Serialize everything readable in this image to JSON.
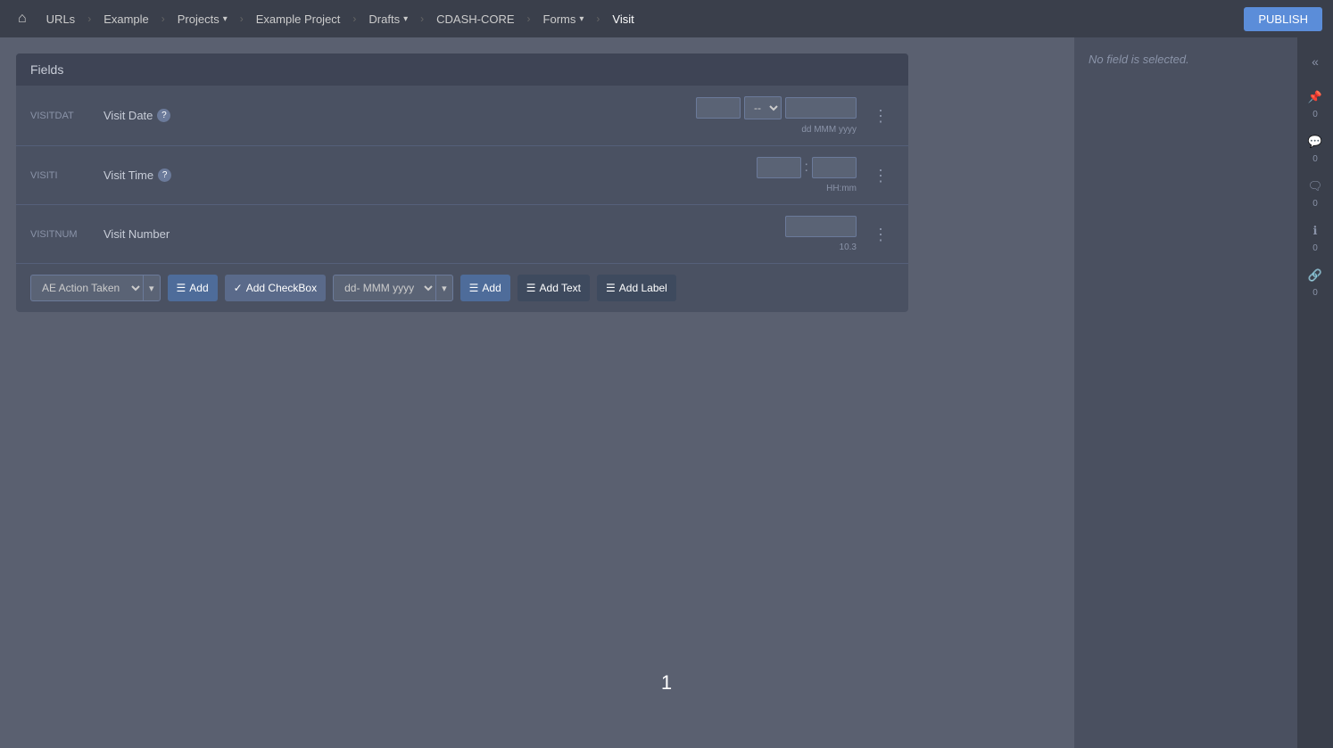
{
  "nav": {
    "home_icon": "⌂",
    "items": [
      {
        "label": "URLs",
        "has_arrow": false
      },
      {
        "label": "Example",
        "has_arrow": false
      },
      {
        "label": "Projects",
        "has_arrow": true
      },
      {
        "label": "Example Project",
        "has_arrow": false
      },
      {
        "label": "Drafts",
        "has_arrow": true
      },
      {
        "label": "CDASH-CORE",
        "has_arrow": false
      },
      {
        "label": "Forms",
        "has_arrow": true
      },
      {
        "label": "Visit",
        "has_arrow": false,
        "active": true
      }
    ],
    "publish_label": "PUBLISH"
  },
  "fields_panel": {
    "header": "Fields",
    "rows": [
      {
        "id": "VISITDAT",
        "label": "Visit Date",
        "has_help": true,
        "type": "date",
        "hint": "dd MMM yyyy"
      },
      {
        "id": "VISITI",
        "label": "Visit Time",
        "has_help": true,
        "type": "time",
        "hint": "HH:mm"
      },
      {
        "id": "VISITNUM",
        "label": "Visit Number",
        "has_help": false,
        "type": "number",
        "hint": "10.3"
      }
    ]
  },
  "toolbar": {
    "dropdown_label": "AE Action Taken",
    "add_label": "Add",
    "add_checkbox_label": "Add CheckBox",
    "date_format": "dd- MMM yyyy",
    "add_date_label": "Add",
    "add_text_label": "Add Text",
    "add_label_label": "Add Label"
  },
  "right_sidebar": {
    "icons": [
      {
        "name": "collapse-icon",
        "symbol": "«",
        "count": null
      },
      {
        "name": "pin-icon",
        "symbol": "📌",
        "count": "0"
      },
      {
        "name": "comment-icon",
        "symbol": "💬",
        "count": "0"
      },
      {
        "name": "chat-icon",
        "symbol": "🗨",
        "count": "0"
      },
      {
        "name": "info-icon",
        "symbol": "ℹ",
        "count": "0"
      },
      {
        "name": "link-icon",
        "symbol": "🔗",
        "count": "0"
      }
    ]
  },
  "no_field_panel": {
    "text": "No field is selected."
  },
  "page": {
    "number": "1"
  }
}
